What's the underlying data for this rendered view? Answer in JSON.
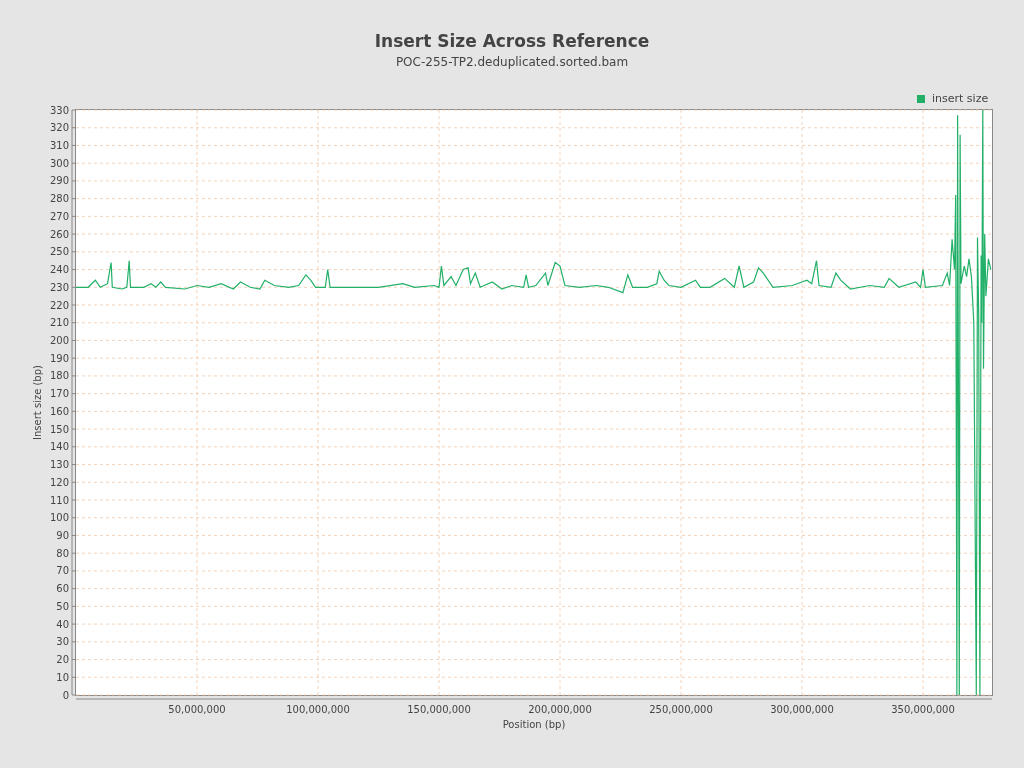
{
  "chart_data": {
    "type": "line",
    "title": "Insert Size Across Reference",
    "subtitle": "POC-255-TP2.deduplicated.sorted.bam",
    "xlabel": "Position (bp)",
    "ylabel": "Insert size (bp)",
    "xlim": [
      0,
      378500000
    ],
    "ylim": [
      0,
      330
    ],
    "grid": true,
    "xticks": [
      {
        "value": 50000000,
        "label": "50,000,000"
      },
      {
        "value": 100000000,
        "label": "100,000,000"
      },
      {
        "value": 150000000,
        "label": "150,000,000"
      },
      {
        "value": 200000000,
        "label": "200,000,000"
      },
      {
        "value": 250000000,
        "label": "250,000,000"
      },
      {
        "value": 300000000,
        "label": "300,000,000"
      },
      {
        "value": 350000000,
        "label": "350,000,000"
      }
    ],
    "yticks": [
      0,
      10,
      20,
      30,
      40,
      50,
      60,
      70,
      80,
      90,
      100,
      110,
      120,
      130,
      140,
      150,
      160,
      170,
      180,
      190,
      200,
      210,
      220,
      230,
      240,
      250,
      260,
      270,
      280,
      290,
      300,
      310,
      320,
      330
    ],
    "x": [
      0,
      5000000,
      8000000,
      10000000,
      13000000,
      14000000,
      14500000,
      15000000,
      19000000,
      21000000,
      22000000,
      22500000,
      28000000,
      31000000,
      33000000,
      35000000,
      37000000,
      45000000,
      50000000,
      55000000,
      60000000,
      65000000,
      68000000,
      72000000,
      76000000,
      78000000,
      82000000,
      88000000,
      92000000,
      95000000,
      97000000,
      99000000,
      103000000,
      104000000,
      105000000,
      115000000,
      125000000,
      135000000,
      140000000,
      148000000,
      150000000,
      151000000,
      152000000,
      155000000,
      157000000,
      160000000,
      162000000,
      163000000,
      165000000,
      167000000,
      172000000,
      176000000,
      180000000,
      185000000,
      186000000,
      187000000,
      190000000,
      194000000,
      195000000,
      198000000,
      200000000,
      202000000,
      208000000,
      215000000,
      220000000,
      226000000,
      228000000,
      230000000,
      236000000,
      240000000,
      241000000,
      243000000,
      245000000,
      250000000,
      256000000,
      258000000,
      262000000,
      268000000,
      272000000,
      274000000,
      276000000,
      280000000,
      282000000,
      284000000,
      288000000,
      296000000,
      302000000,
      304000000,
      306000000,
      307000000,
      312000000,
      314000000,
      316000000,
      320000000,
      328000000,
      334000000,
      336000000,
      340000000,
      347000000,
      349000000,
      350000000,
      351000000,
      358000000,
      360000000,
      361000000,
      362000000,
      363000000,
      363500000,
      364000000,
      364300000,
      364600000,
      365000000,
      365300000,
      365700000,
      367000000,
      368000000,
      369000000,
      370000000,
      371000000,
      372000000,
      372500000,
      373000000,
      373500000,
      374000000,
      374300000,
      374700000,
      375000000,
      375500000,
      376000000,
      377000000,
      378000000
    ],
    "series": [
      {
        "name": "insert size",
        "color": "#22b068",
        "values": [
          230,
          230,
          234,
          230,
          232,
          240,
          244,
          230,
          229,
          230,
          245,
          230,
          230,
          232,
          230,
          233,
          230,
          229,
          231,
          230,
          232,
          229,
          233,
          230,
          229,
          234,
          231,
          230,
          231,
          237,
          234,
          230,
          230,
          240,
          230,
          230,
          230,
          232,
          230,
          231,
          230,
          242,
          231,
          236,
          231,
          240,
          241,
          232,
          238,
          230,
          233,
          229,
          231,
          230,
          237,
          230,
          231,
          238,
          231,
          244,
          242,
          231,
          230,
          231,
          230,
          227,
          237,
          230,
          230,
          232,
          239,
          234,
          231,
          230,
          234,
          230,
          230,
          235,
          230,
          242,
          230,
          233,
          241,
          238,
          230,
          231,
          234,
          232,
          245,
          231,
          230,
          238,
          234,
          229,
          231,
          230,
          235,
          230,
          233,
          230,
          240,
          230,
          231,
          238,
          231,
          257,
          240,
          282,
          0,
          327,
          180,
          0,
          316,
          232,
          242,
          236,
          246,
          236,
          210,
          0,
          258,
          214,
          0,
          248,
          210,
          330,
          184,
          260,
          225,
          246,
          240
        ]
      }
    ]
  }
}
